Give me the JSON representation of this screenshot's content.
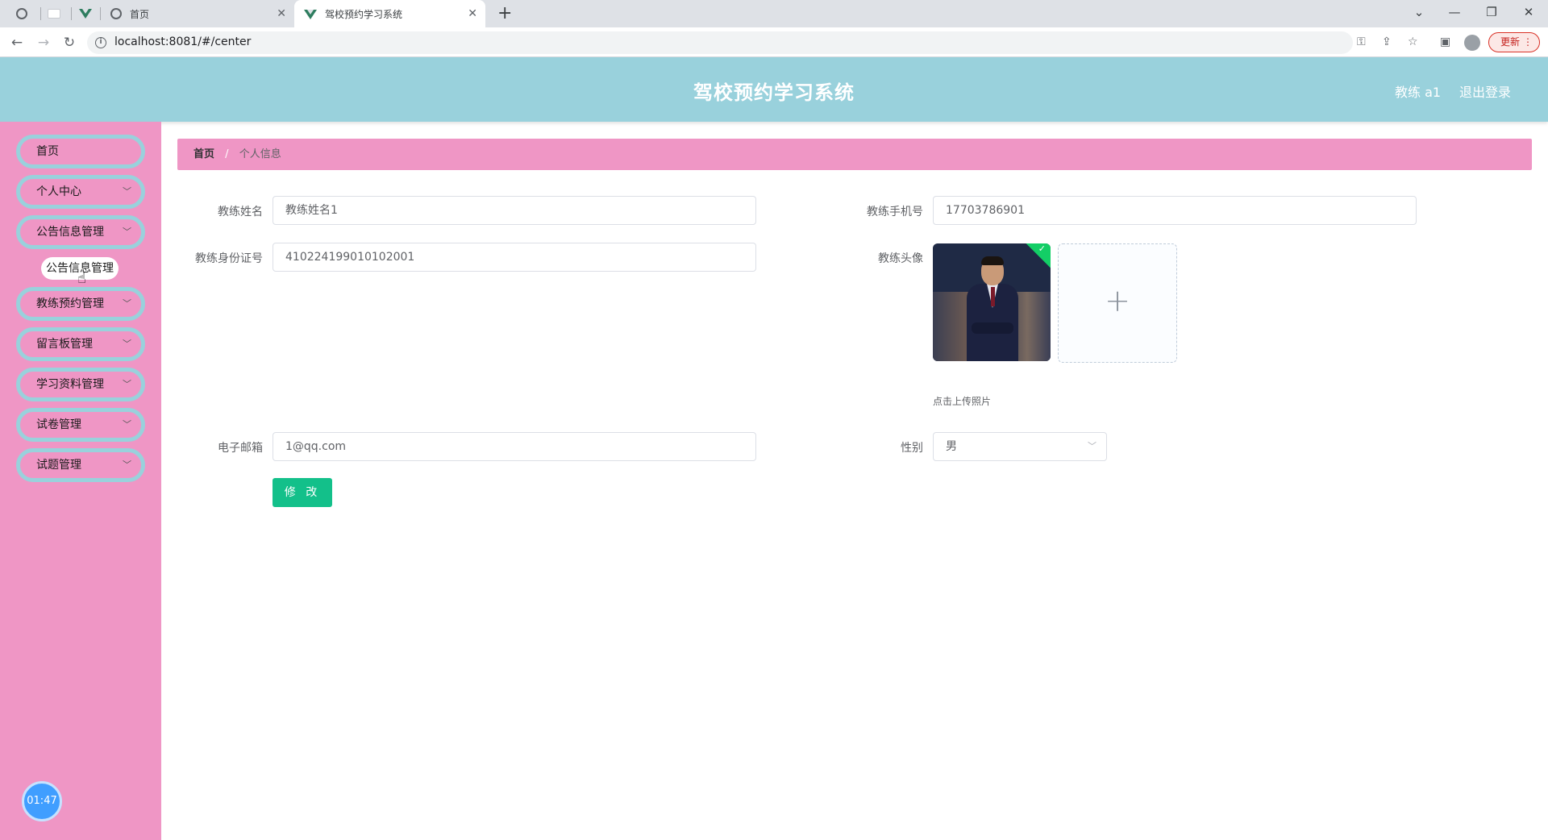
{
  "browser": {
    "tabs": [
      {
        "title": "首页",
        "close": "✕"
      },
      {
        "title": "驾校预约学习系统",
        "close": "✕"
      }
    ],
    "new_tab": "+",
    "window_controls": {
      "minimize": "—",
      "restore": "❐",
      "close": "✕",
      "menu": "⌄"
    },
    "nav": {
      "back": "←",
      "forward": "→",
      "reload": "↻"
    },
    "url": "localhost:8081/#/center",
    "update_label": "更新",
    "menu_dots": "⋮",
    "icons": [
      "globe-icon",
      "vue-icon",
      "info-icon",
      "key-icon",
      "share-icon",
      "star-icon",
      "sidepanel-icon",
      "profile-icon"
    ]
  },
  "header": {
    "title": "驾校预约学习系统",
    "user": "教练 a1",
    "logout": "退出登录",
    "background": "#99d1dc"
  },
  "sidebar": {
    "background": "#ef96c5",
    "items": [
      {
        "label": "首页",
        "has_arrow": false
      },
      {
        "label": "个人中心",
        "has_arrow": true
      },
      {
        "label": "公告信息管理",
        "has_arrow": true
      },
      {
        "label": "教练预约管理",
        "has_arrow": true
      },
      {
        "label": "留言板管理",
        "has_arrow": true
      },
      {
        "label": "学习资料管理",
        "has_arrow": true
      },
      {
        "label": "试卷管理",
        "has_arrow": true
      },
      {
        "label": "试题管理",
        "has_arrow": true
      }
    ],
    "arrow_glyph": "﹀",
    "submenu_open": "公告信息管理",
    "timer": "01:47"
  },
  "breadcrumb": {
    "home": "首页",
    "separator": "/",
    "current": "个人信息"
  },
  "form": {
    "name_label": "教练姓名",
    "name_value": "教练姓名1",
    "phone_label": "教练手机号",
    "phone_value": "17703786901",
    "idcard_label": "教练身份证号",
    "idcard_value": "410224199010102001",
    "avatar_label": "教练头像",
    "upload_plus": "+",
    "upload_tip": "点击上传照片",
    "email_label": "电子邮箱",
    "email_value": "1@qq.com",
    "gender_label": "性别",
    "gender_value": "男",
    "select_arrow": "﹀",
    "submit_label": "修 改",
    "submit_color": "#13c08a"
  }
}
